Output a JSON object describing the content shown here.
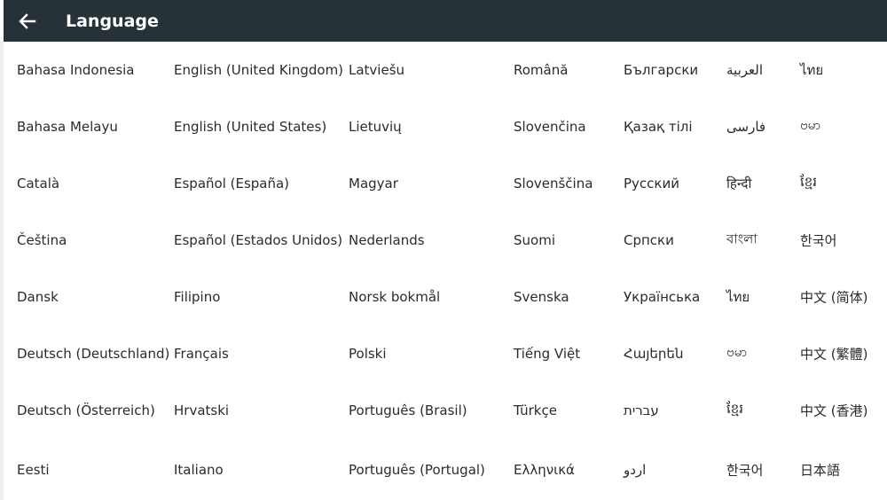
{
  "header": {
    "title": "Language",
    "back_icon": "arrow-back-icon"
  },
  "columns": [
    [
      "Bahasa Indonesia",
      "Bahasa Melayu",
      "Català",
      "Čeština",
      "Dansk",
      "Deutsch (Deutschland)",
      "Deutsch (Österreich)",
      "Eesti"
    ],
    [
      "English (United Kingdom)",
      "English (United States)",
      "Español (España)",
      "Español (Estados Unidos)",
      "Filipino",
      "Français",
      "Hrvatski",
      "Italiano"
    ],
    [
      "Latviešu",
      "Lietuvių",
      "Magyar",
      "Nederlands",
      "Norsk bokmål",
      "Polski",
      "Português (Brasil)",
      "Português (Portugal)"
    ],
    [
      "Română",
      "Slovenčina",
      "Slovenščina",
      "Suomi",
      "Svenska",
      "Tiếng Việt",
      "Türkçe",
      "Ελληνικά"
    ],
    [
      "Български",
      "Қазақ тілі",
      "Русский",
      "Српски",
      "Українська",
      "Հայերեն",
      "עברית",
      "اردو"
    ],
    [
      "العربية",
      "فارسی",
      "हिन्दी",
      "বাংলা",
      "ไทย",
      "ဗမာ",
      "ខ្មែរ",
      "한국어"
    ],
    [
      "ไทย",
      "ဗမာ",
      "ខ្មែរ",
      "한국어",
      "中文 (简体)",
      "中文 (繁體)",
      "中文 (香港)",
      "日本語"
    ]
  ]
}
